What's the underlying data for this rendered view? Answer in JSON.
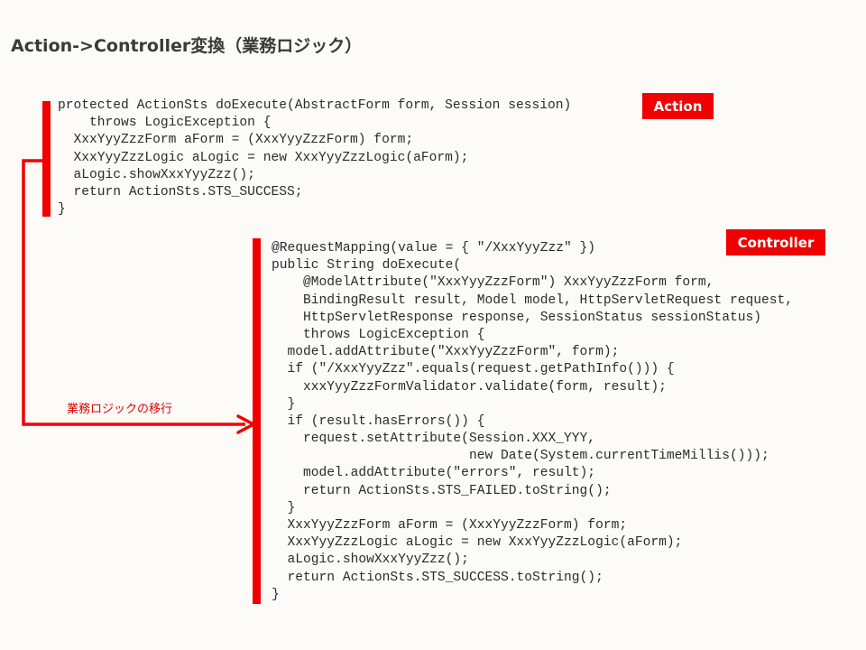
{
  "title": "Action->Controller変換（業務ロジック）",
  "action": {
    "tag": "Action",
    "code_lines": [
      "protected ActionSts doExecute(AbstractForm form, Session session)",
      "    throws LogicException {",
      "  XxxYyyZzzForm aForm = (XxxYyyZzzForm) form;",
      "  XxxYyyZzzLogic aLogic = new XxxYyyZzzLogic(aForm);",
      "  aLogic.showXxxYyyZzz();",
      "  return ActionSts.STS_SUCCESS;",
      "}"
    ]
  },
  "controller": {
    "tag": "Controller",
    "code_lines": [
      "@RequestMapping(value = { \"/XxxYyyZzz\" })",
      "public String doExecute(",
      "    @ModelAttribute(\"XxxYyyZzzForm\") XxxYyyZzzForm form,",
      "    BindingResult result, Model model, HttpServletRequest request,",
      "    HttpServletResponse response, SessionStatus sessionStatus)",
      "    throws LogicException {",
      "  model.addAttribute(\"XxxYyyZzzForm\", form);",
      "  if (\"/XxxYyyZzz\".equals(request.getPathInfo())) {",
      "    xxxYyyZzzFormValidator.validate(form, result);",
      "  }",
      "  if (result.hasErrors()) {",
      "    request.setAttribute(Session.XXX_YYY,",
      "                         new Date(System.currentTimeMillis()));",
      "    model.addAttribute(\"errors\", result);",
      "    return ActionSts.STS_FAILED.toString();",
      "  }",
      "  XxxYyyZzzForm aForm = (XxxYyyZzzForm) form;",
      "  XxxYyyZzzLogic aLogic = new XxxYyyZzzLogic(aForm);",
      "  aLogic.showXxxYyyZzz();",
      "  return ActionSts.STS_SUCCESS.toString();",
      "}"
    ]
  },
  "arrow": {
    "label": "業務ロジックの移行"
  },
  "colors": {
    "accent": "#f00000",
    "background": "#fcfbf8",
    "code_text": "#2b2b2b",
    "title_text": "#3a3a3a"
  }
}
